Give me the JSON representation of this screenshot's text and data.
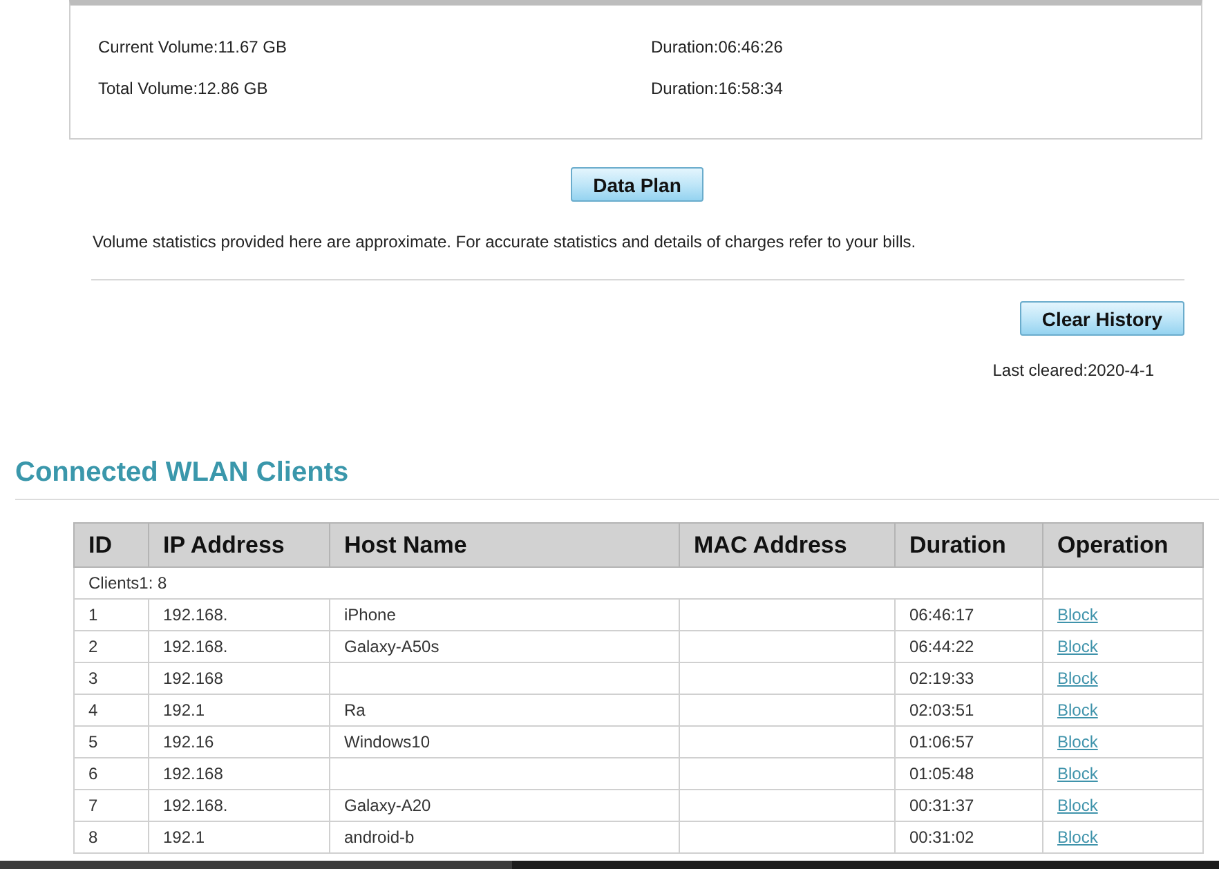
{
  "volume_panel": {
    "rows": [
      {
        "volume": "Current Volume:11.67 GB",
        "duration": "Duration:06:46:26"
      },
      {
        "volume": "Total Volume:12.86 GB",
        "duration": "Duration:16:58:34"
      }
    ]
  },
  "data_plan_button": "Data Plan",
  "note": "Volume statistics provided here are approximate. For accurate statistics and details of charges refer to your bills.",
  "clear_history_button": "Clear History",
  "last_cleared": "Last cleared:2020-4-1",
  "clients": {
    "title": "Connected WLAN Clients",
    "columns": [
      "ID",
      "IP Address",
      "Host Name",
      "MAC Address",
      "Duration",
      "Operation"
    ],
    "summary": "Clients1: 8",
    "rows": [
      {
        "id": "1",
        "ip_address": "192.168.",
        "host_name": "iPhone",
        "duration": "06:46:17",
        "operation": "Block"
      },
      {
        "id": "2",
        "ip_address": "192.168.",
        "host_name": "Galaxy-A50s",
        "duration": "06:44:22",
        "operation": "Block"
      },
      {
        "id": "3",
        "ip_address": "192.168",
        "duration": "02:19:33",
        "operation": "Block"
      },
      {
        "id": "4",
        "ip_address": "192.1",
        "host_name": "Ra",
        "duration": "02:03:51",
        "operation": "Block"
      },
      {
        "id": "5",
        "ip_address": "192.16",
        "host_name": "Windows10",
        "duration": "01:06:57",
        "operation": "Block"
      },
      {
        "id": "6",
        "ip_address": "192.168",
        "duration": "01:05:48",
        "operation": "Block"
      },
      {
        "id": "7",
        "ip_address": "192.168.",
        "host_name": "Galaxy-A20",
        "duration": "00:31:37",
        "operation": "Block"
      },
      {
        "id": "8",
        "ip_address": "192.1",
        "host_name": "android-b",
        "duration": "00:31:02",
        "operation": "Block"
      }
    ]
  }
}
